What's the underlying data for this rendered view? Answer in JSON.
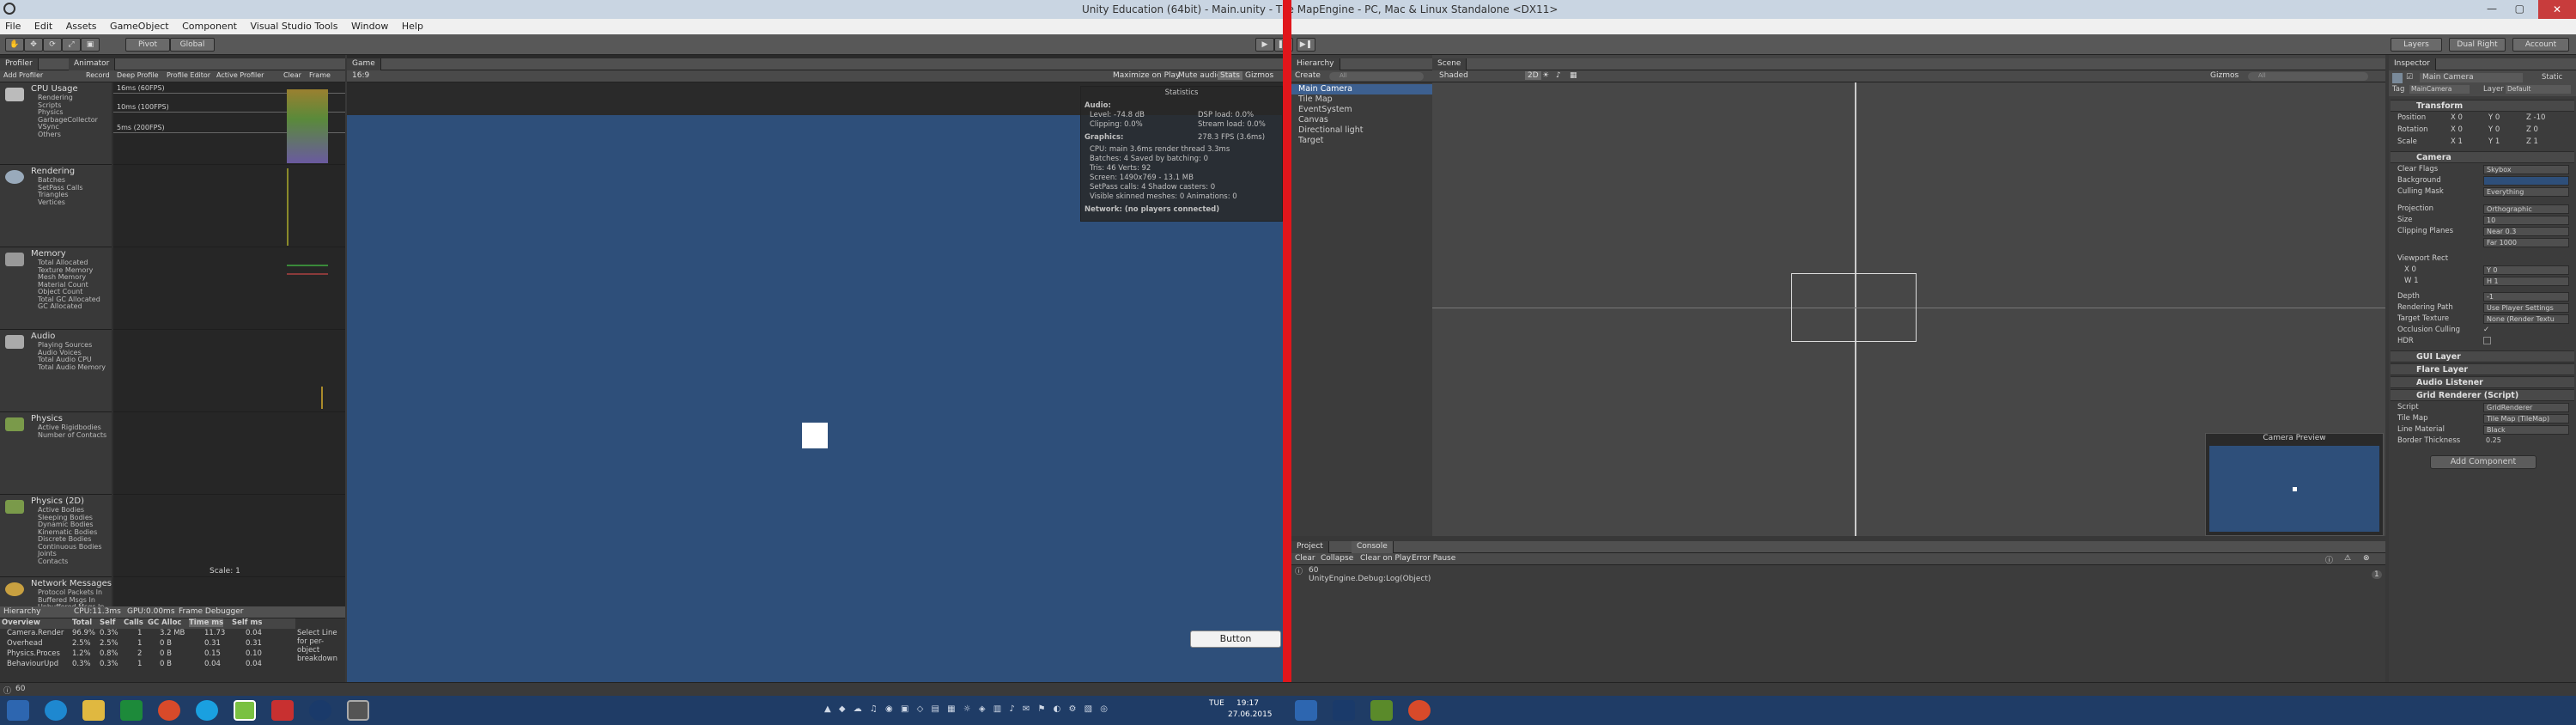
{
  "window": {
    "title": "Unity Education (64bit) - Main.unity - Tile MapEngine - PC, Mac & Linux Standalone <DX11>"
  },
  "menu": [
    "File",
    "Edit",
    "Assets",
    "GameObject",
    "Component",
    "Visual Studio Tools",
    "Window",
    "Help"
  ],
  "toolbar": {
    "pivot": "Pivot",
    "global": "Global",
    "layers": "Layers",
    "layout": "Dual Right",
    "account": "Account"
  },
  "profiler": {
    "tab": "Profiler",
    "tab2": "Animator",
    "buttons": [
      "Add Profiler",
      "Record",
      "Deep Profile",
      "Profile Editor",
      "Active Profiler",
      "Clear",
      "Frame"
    ],
    "fps_labels": [
      "16ms (60FPS)",
      "10ms (100FPS)",
      "5ms (200FPS)"
    ],
    "sections": [
      {
        "name": "CPU Usage",
        "items": [
          "Rendering",
          "Scripts",
          "Physics",
          "GarbageCollector",
          "VSync",
          "Others"
        ]
      },
      {
        "name": "Rendering",
        "items": [
          "Batches",
          "SetPass Calls",
          "Triangles",
          "Vertices"
        ]
      },
      {
        "name": "Memory",
        "items": [
          "Total Allocated",
          "Texture Memory",
          "Mesh Memory",
          "Material Count",
          "Object Count",
          "Total GC Allocated",
          "GC Allocated"
        ]
      },
      {
        "name": "Audio",
        "items": [
          "Playing Sources",
          "Audio Voices",
          "Total Audio CPU",
          "Total Audio Memory"
        ]
      },
      {
        "name": "Physics",
        "items": [
          "Active Rigidbodies",
          "Number of Contacts"
        ]
      },
      {
        "name": "Physics (2D)",
        "items": [
          "Active Bodies",
          "Sleeping Bodies",
          "Dynamic Bodies",
          "Kinematic Bodies",
          "Discrete Bodies",
          "Continuous Bodies",
          "Joints",
          "Contacts"
        ]
      },
      {
        "name": "Network Messages",
        "items": [
          "Protocol Packets In",
          "Buffered Msgs In",
          "Unbuffered Msgs In"
        ]
      }
    ],
    "scale": "Scale: 1",
    "bottom_tabs": [
      "Hierarchy",
      "CPU:11.3ms",
      "GPU:0.00ms",
      "Frame Debugger"
    ],
    "table": {
      "headers": [
        "Overview",
        "Total",
        "Self",
        "Calls",
        "GC Alloc",
        "Time ms",
        "Self ms"
      ],
      "rows": [
        [
          "Camera.Render",
          "96.9%",
          "0.3%",
          "1",
          "3.2 MB",
          "11.73",
          "0.04"
        ],
        [
          "Overhead",
          "2.5%",
          "2.5%",
          "1",
          "0 B",
          "0.31",
          "0.31"
        ],
        [
          "Physics.Proces",
          "1.2%",
          "0.8%",
          "2",
          "0 B",
          "0.15",
          "0.10"
        ],
        [
          "BehaviourUpd",
          "0.3%",
          "0.3%",
          "1",
          "0 B",
          "0.04",
          "0.04"
        ]
      ],
      "hint": "Select Line for per-object breakdown"
    }
  },
  "game": {
    "tab": "Game",
    "aspect": "16:9",
    "controls": [
      "Maximize on Play",
      "Mute audio",
      "Stats",
      "Gizmos"
    ],
    "button_label": "Button",
    "stats": {
      "title": "Statistics",
      "audio_hdr": "Audio:",
      "audio_lines": [
        "Level: -74.8 dB",
        "DSP load: 0.0%",
        "Clipping: 0.0%",
        "Stream load: 0.0%"
      ],
      "graphics_hdr": "Graphics:",
      "fps": "278.3 FPS (3.6ms)",
      "graphics_lines": [
        "CPU: main 3.6ms  render thread 3.3ms",
        "Batches: 4   Saved by batching: 0",
        "Tris: 46   Verts: 92",
        "Screen: 1490x769 - 13.1 MB",
        "SetPass calls: 4   Shadow casters: 0",
        "Visible skinned meshes: 0   Animations: 0"
      ],
      "network": "Network: (no players connected)"
    }
  },
  "hierarchy": {
    "tab": "Hierarchy",
    "create": "Create",
    "search": "All",
    "items": [
      "Main Camera",
      "Tile Map",
      "EventSystem",
      "Canvas",
      "Directional light",
      "Target"
    ]
  },
  "scene": {
    "tab": "Scene",
    "shading": "Shaded",
    "mode": "2D",
    "gizmos": "Gizmos",
    "search": "All",
    "preview_title": "Camera Preview"
  },
  "inspector": {
    "tab": "Inspector",
    "object_name": "Main Camera",
    "static": "Static",
    "tag_label": "Tag",
    "tag": "MainCamera",
    "layer_label": "Layer",
    "layer": "Default",
    "transform": "Transform",
    "position": [
      "Position",
      "X 0",
      "Y 0",
      "Z -10"
    ],
    "rotation": [
      "Rotation",
      "X 0",
      "Y 0",
      "Z 0"
    ],
    "scale": [
      "Scale",
      "X 1",
      "Y 1",
      "Z 1"
    ],
    "camera": "Camera",
    "camera_props": [
      [
        "Clear Flags",
        "Skybox"
      ],
      [
        "Background",
        ""
      ],
      [
        "Culling Mask",
        "Everything"
      ],
      [
        "Projection",
        "Orthographic"
      ],
      [
        "Size",
        "10"
      ],
      [
        "Clipping Planes",
        "Near 0.3"
      ],
      [
        "",
        "Far 1000"
      ],
      [
        "Viewport Rect",
        ""
      ],
      [
        "X 0",
        "Y 0"
      ],
      [
        "W 1",
        "H 1"
      ],
      [
        "Depth",
        "-1"
      ],
      [
        "Rendering Path",
        "Use Player Settings"
      ],
      [
        "Target Texture",
        "None (Render Textu"
      ],
      [
        "Occlusion Culling",
        "✓"
      ],
      [
        "HDR",
        ""
      ]
    ],
    "components": [
      "GUI Layer",
      "Flare Layer",
      "Audio Listener",
      "Grid Renderer (Script)"
    ],
    "grid_props": [
      [
        "Script",
        "GridRenderer"
      ],
      [
        "Tile Map",
        "Tile Map (TileMap)"
      ],
      [
        "Line Material",
        "Black"
      ],
      [
        "Border Thickness",
        "0.25"
      ]
    ],
    "add_component": "Add Component"
  },
  "console": {
    "tabs": [
      "Project",
      "Console"
    ],
    "buttons": [
      "Clear",
      "Collapse",
      "Clear on Play",
      "Error Pause"
    ],
    "log_line1": "60",
    "log_line2": "UnityEngine.Debug:Log(Object)",
    "count": "1",
    "status": "60"
  },
  "taskbar": {
    "time": "19:17",
    "date": "27.06.2015",
    "day": "TUE"
  },
  "colors": {
    "game_bg": "#2e4f7a",
    "divider": "#e0161b",
    "taskbar": "#1f3c66"
  }
}
